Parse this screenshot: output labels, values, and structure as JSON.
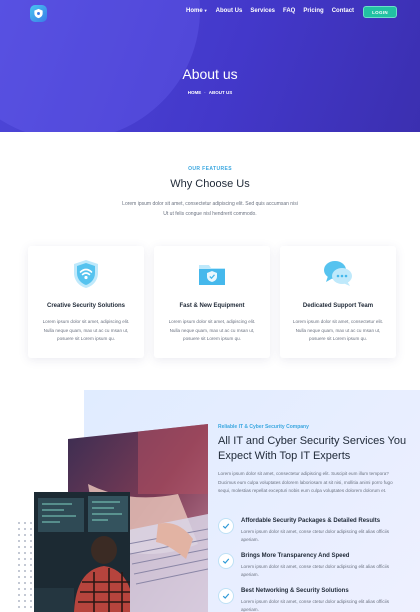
{
  "nav": {
    "items": [
      "Home",
      "About Us",
      "Services",
      "FAQ",
      "Pricing",
      "Contact"
    ],
    "login_label": "LOGIN"
  },
  "hero": {
    "title": "About us",
    "breadcrumb": [
      "HOME",
      "ABOUT US"
    ],
    "background_color": "#4338ca"
  },
  "features": {
    "eyebrow": "OUR FEATURES",
    "title": "Why Choose Us",
    "subtitle": "Lorem ipsum dolor sit amet, consectetur adipiscing elit. Sed quis accumsan nisi Ut ut felis congue nisl hendrerit commodo.",
    "cards": [
      {
        "icon": "shield-wifi-icon",
        "title": "Creative Security Solutions",
        "text": "Lorem ipsum dolor sit amet, adipiscing elit. Nulla neque quam, max ut ac cu msan ut, posuere sit Lorem ipsum qu."
      },
      {
        "icon": "secure-folder-icon",
        "title": "Fast & New Equipment",
        "text": "Lorem ipsum dolor sit amet, adipiscing elit. Nulla neque quam, max ut ac cu msan ut, posuere sit Lorem ipsum qu."
      },
      {
        "icon": "chat-bubbles-icon",
        "title": "Dedicated Support Team",
        "text": "Lorem ipsum dolor sit amet, consectetur elit. Nulla neque quam, max ut ac cu msan ut, posuere sit Lorem ipsum qu."
      }
    ]
  },
  "about": {
    "eyebrow": "Reliable IT & Cyber Security Company",
    "title": "All IT and Cyber Security Services You Expect With Top IT Experts",
    "text": "Lorem ipsum dolor sit amet, consectetur adipiscing elit. Suscipit eum illum tempora? Ducimus eum culpa voluptates dolorem laboriosam at sit nisi, mollitia animi porro fugo sequi, molestias repellat excepturi nobis eum culpa voluptates dolorem dolorum et.",
    "features": [
      {
        "title": "Affordable Security Packages & Detailed Results",
        "text": "Lorem ipsum dolor sit amet, conse ctetur dolor adipiscing elit alias officiis aperiam."
      },
      {
        "title": "Brings More Transparency And Speed",
        "text": "Lorem ipsum dolor sit amet, conse ctetur dolor adipiscing elit alias officiis aperiam."
      },
      {
        "title": "Best Networking & Security Solutions",
        "text": "Lorem ipsum dolor sit amet, conse ctetur dolor adipiscing elit alias officiis aperiam."
      }
    ]
  },
  "colors": {
    "accent": "#3aa7e0",
    "login": "#22c1a3",
    "heading": "#1f2937"
  }
}
